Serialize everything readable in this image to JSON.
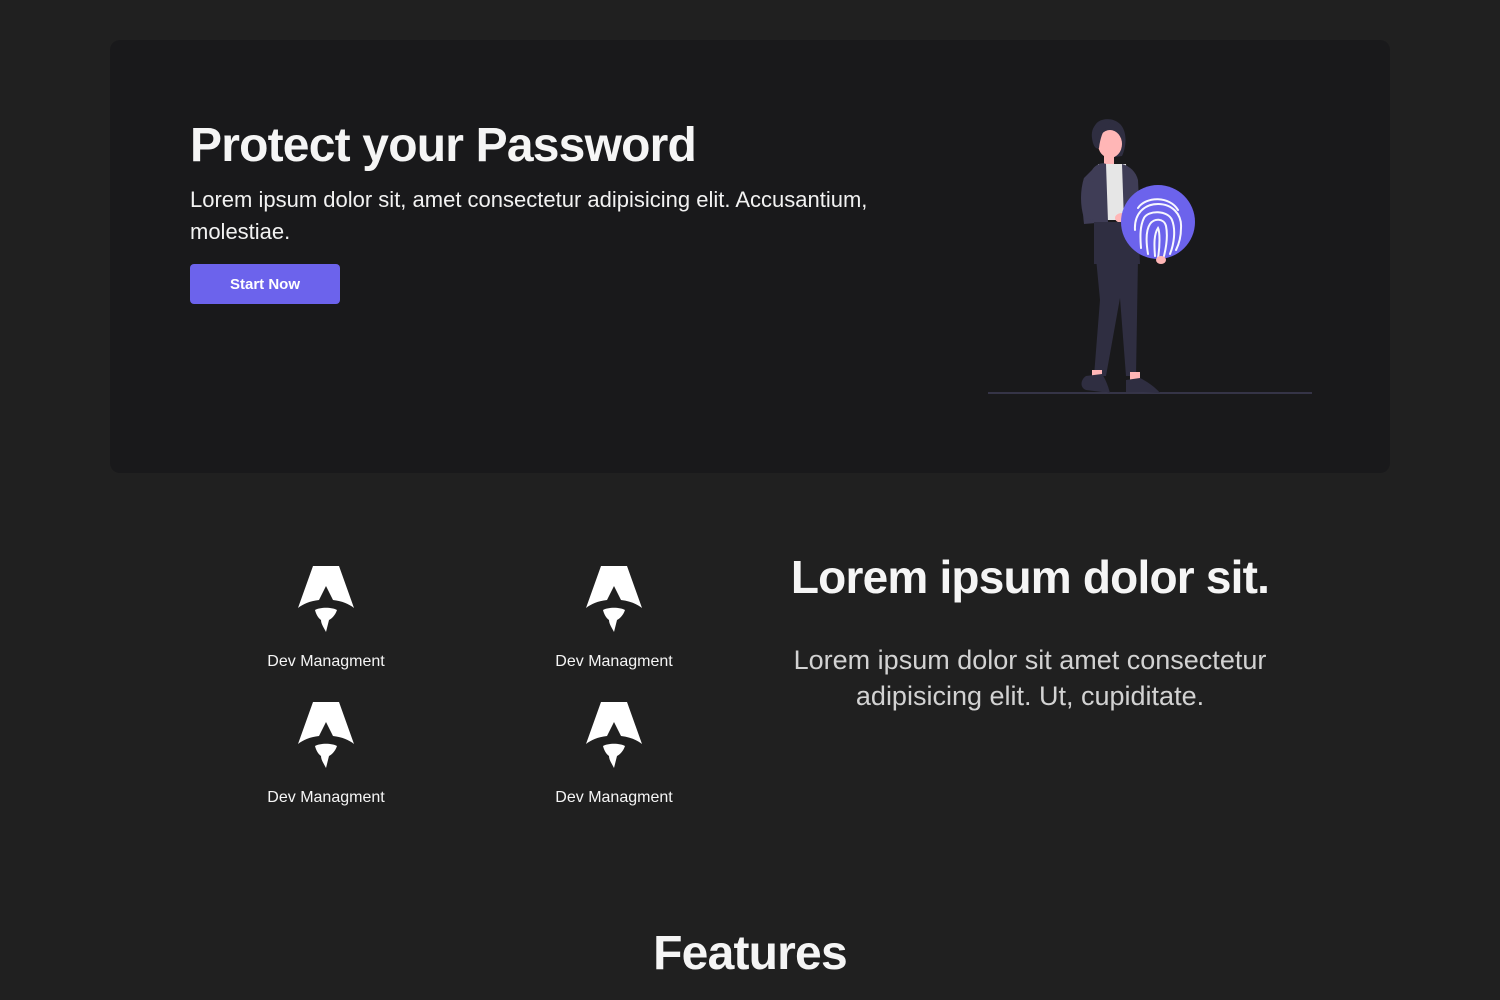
{
  "hero": {
    "title": "Protect your Password",
    "subtitle": "Lorem ipsum dolor sit, amet consectetur adipisicing elit. Accusantium, molestiae.",
    "cta_label": "Start Now",
    "accent_color": "#6c63ec",
    "illustration_icon": "person-holding-fingerprint-icon"
  },
  "features_grid": {
    "logo_icon": "rocket-a-logo-icon",
    "items": [
      {
        "label": "Dev Managment"
      },
      {
        "label": "Dev Managment"
      },
      {
        "label": "Dev Managment"
      },
      {
        "label": "Dev Managment"
      }
    ]
  },
  "info": {
    "title": "Lorem ipsum dolor sit.",
    "text": "Lorem ipsum dolor sit amet consectetur adipisicing elit. Ut, cupiditate."
  },
  "features_section": {
    "heading": "Features"
  }
}
